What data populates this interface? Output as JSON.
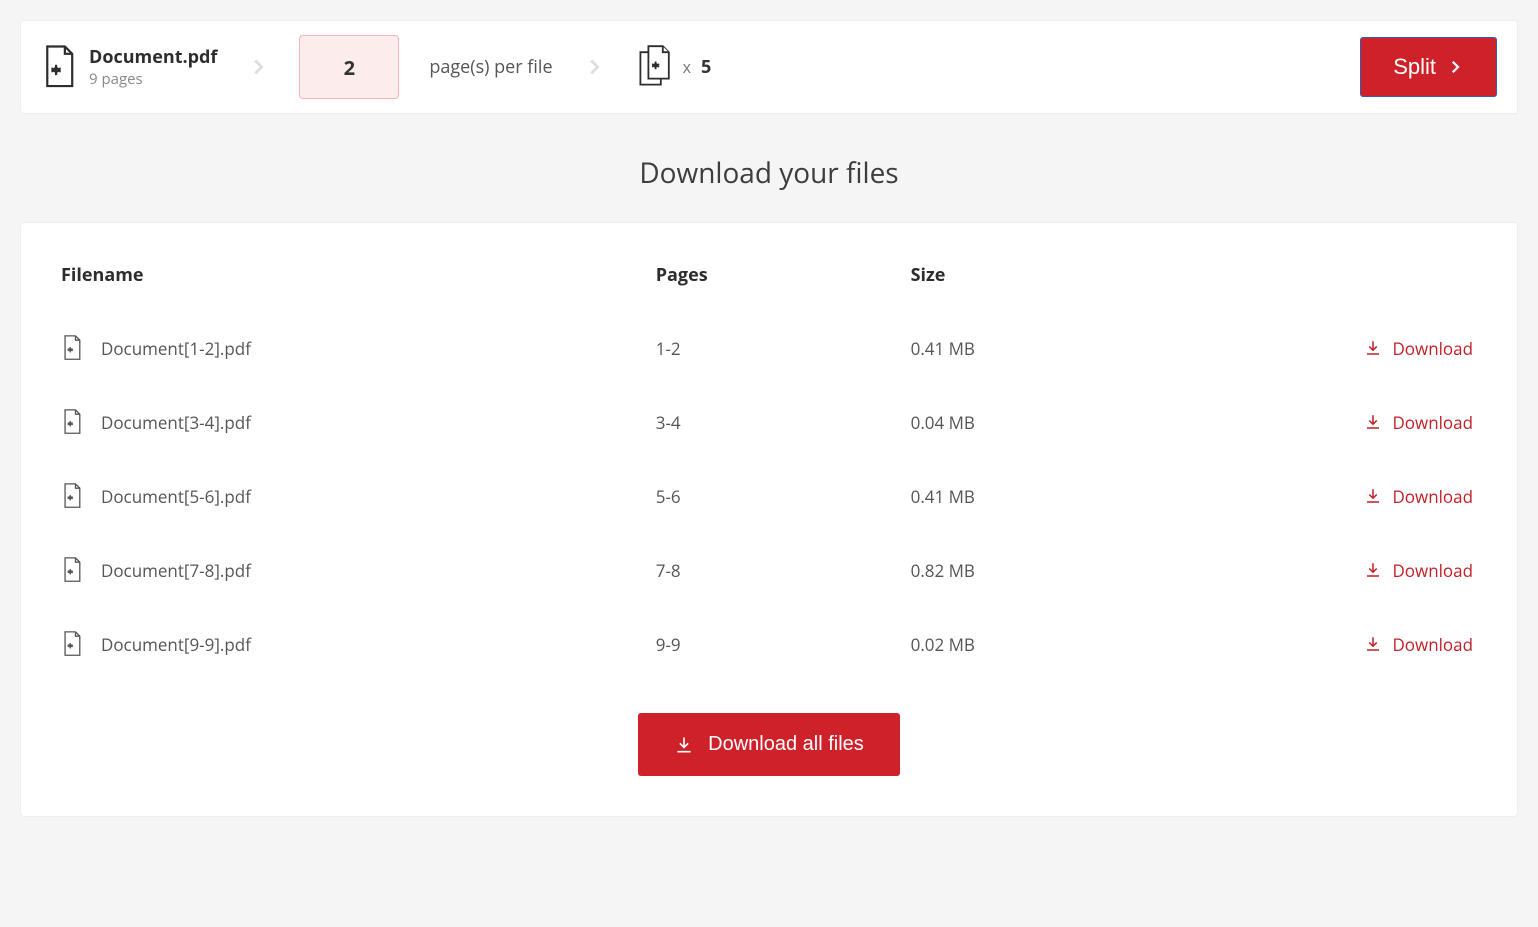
{
  "topbar": {
    "doc_name": "Document.pdf",
    "doc_pages": "9 pages",
    "pages_per_file_value": "2",
    "pages_per_file_label": "page(s) per file",
    "result_multiplier_prefix": "x",
    "result_count": "5",
    "split_label": "Split"
  },
  "heading": "Download your files",
  "table": {
    "col_filename": "Filename",
    "col_pages": "Pages",
    "col_size": "Size",
    "download_label": "Download",
    "rows": [
      {
        "name": "Document[1-2].pdf",
        "pages": "1-2",
        "size": "0.41 MB"
      },
      {
        "name": "Document[3-4].pdf",
        "pages": "3-4",
        "size": "0.04 MB"
      },
      {
        "name": "Document[5-6].pdf",
        "pages": "5-6",
        "size": "0.41 MB"
      },
      {
        "name": "Document[7-8].pdf",
        "pages": "7-8",
        "size": "0.82 MB"
      },
      {
        "name": "Document[9-9].pdf",
        "pages": "9-9",
        "size": "0.02 MB"
      }
    ]
  },
  "download_all_label": "Download all files"
}
